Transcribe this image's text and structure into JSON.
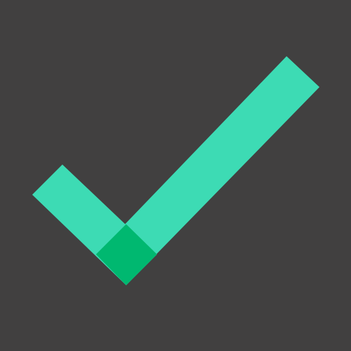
{
  "icon": {
    "name": "checkmark-icon",
    "background_color": "#414040",
    "check_color": "#3DDBB4",
    "joint_color": "#00B870"
  }
}
